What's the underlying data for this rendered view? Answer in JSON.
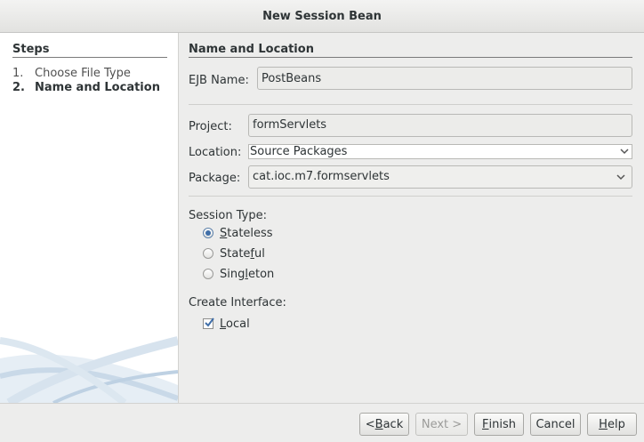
{
  "window": {
    "title": "New Session Bean"
  },
  "steps": {
    "title": "Steps",
    "items": [
      {
        "num": "1.",
        "label": "Choose File Type"
      },
      {
        "num": "2.",
        "label": "Name and Location"
      }
    ]
  },
  "form": {
    "section_title": "Name and Location",
    "ejb_name": {
      "label": "EJB Name:",
      "value": "PostBeans"
    },
    "project": {
      "label": "Project:",
      "value": "formServlets"
    },
    "location": {
      "label": "Location:",
      "value": "Source Packages"
    },
    "package": {
      "label": "Package:",
      "value": "cat.ioc.m7.formservlets"
    },
    "session_type": {
      "label": "Session Type:",
      "options": [
        {
          "mnemonic": "S",
          "rest": "tateless",
          "pre": "",
          "checked": true
        },
        {
          "pre": "State",
          "mnemonic": "f",
          "rest": "ul",
          "checked": false
        },
        {
          "pre": "Sing",
          "mnemonic": "l",
          "rest": "eton",
          "checked": false
        }
      ]
    },
    "create_interface": {
      "label": "Create Interface:",
      "local": {
        "mnemonic": "L",
        "rest": "ocal",
        "checked": true
      }
    }
  },
  "buttons": {
    "back": {
      "pre": "< ",
      "mnemonic": "B",
      "rest": "ack"
    },
    "next": {
      "label": "Next >"
    },
    "finish": {
      "mnemonic": "F",
      "rest": "inish"
    },
    "cancel": {
      "label": "Cancel"
    },
    "help": {
      "mnemonic": "H",
      "rest": "elp"
    }
  }
}
